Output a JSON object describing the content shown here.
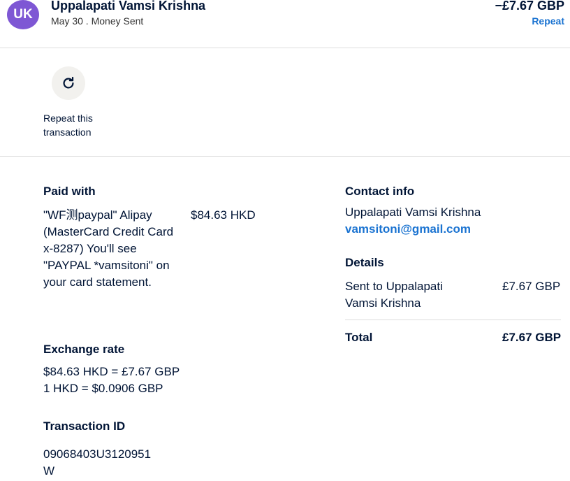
{
  "header": {
    "avatar_initials": "UK",
    "name": "Uppalapati Vamsi Krishna",
    "subtitle": "May 30 . Money Sent",
    "amount": "−£7.67 GBP",
    "repeat_link": "Repeat"
  },
  "action": {
    "repeat_icon": "refresh-icon",
    "repeat_label": "Repeat this transaction"
  },
  "paid_with": {
    "title": "Paid with",
    "source_name": "\"WF测paypal\" Alipay (MasterCard Credit Card x-8287) You'll see \"PAYPAL *vamsitoni\" on your card statement.",
    "amount": "$84.63 HKD"
  },
  "exchange_rate": {
    "title": "Exchange rate",
    "line1": "$84.63 HKD = £7.67 GBP",
    "line2": "1 HKD = $0.0906 GBP"
  },
  "transaction_id": {
    "title": "Transaction ID",
    "value": "09068403U3120951W"
  },
  "contact_info": {
    "title": "Contact info",
    "name": "Uppalapati Vamsi Krishna",
    "email": "vamsitoni@gmail.com"
  },
  "details": {
    "title": "Details",
    "sent_to_label": "Sent to Uppalapati Vamsi Krishna",
    "sent_to_amount": "£7.67 GBP",
    "total_label": "Total",
    "total_amount": "£7.67 GBP"
  },
  "colors": {
    "avatar": "#7e57d4",
    "link": "#1a73d1",
    "text": "#001435"
  }
}
